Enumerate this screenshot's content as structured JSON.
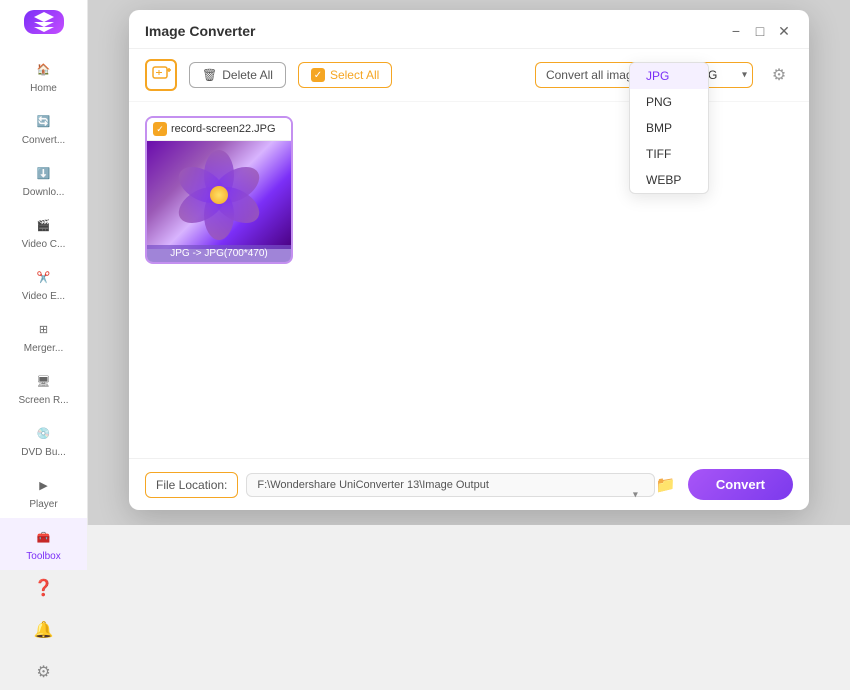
{
  "app": {
    "title": "Image Converter"
  },
  "sidebar": {
    "items": [
      {
        "label": "Home",
        "icon": "home-icon",
        "active": false
      },
      {
        "label": "Convert...",
        "icon": "convert-icon",
        "active": false
      },
      {
        "label": "Downlo...",
        "icon": "download-icon",
        "active": false
      },
      {
        "label": "Video C...",
        "icon": "video-icon",
        "active": false
      },
      {
        "label": "Video E...",
        "icon": "edit-icon",
        "active": false
      },
      {
        "label": "Merger...",
        "icon": "merge-icon",
        "active": false
      },
      {
        "label": "Screen R...",
        "icon": "screen-icon",
        "active": false
      },
      {
        "label": "DVD Bu...",
        "icon": "dvd-icon",
        "active": false
      },
      {
        "label": "Player",
        "icon": "player-icon",
        "active": false
      },
      {
        "label": "Toolbox",
        "icon": "toolbox-icon",
        "active": true
      }
    ]
  },
  "modal": {
    "title": "Image Converter",
    "toolbar": {
      "delete_all_label": "Delete All",
      "select_all_label": "Select All",
      "convert_all_label": "Convert all images to:",
      "settings_icon": "settings-icon"
    },
    "format_options": [
      "JPG",
      "PNG",
      "BMP",
      "TIFF",
      "WEBP"
    ],
    "selected_format": "JPG",
    "image": {
      "filename": "record-screen22.JPG",
      "caption": "JPG -> JPG(700*470)",
      "checked": true
    },
    "footer": {
      "file_location_label": "File Location:",
      "file_path": "F:\\Wondershare UniConverter 13\\Image Output",
      "convert_btn_label": "Convert"
    }
  }
}
